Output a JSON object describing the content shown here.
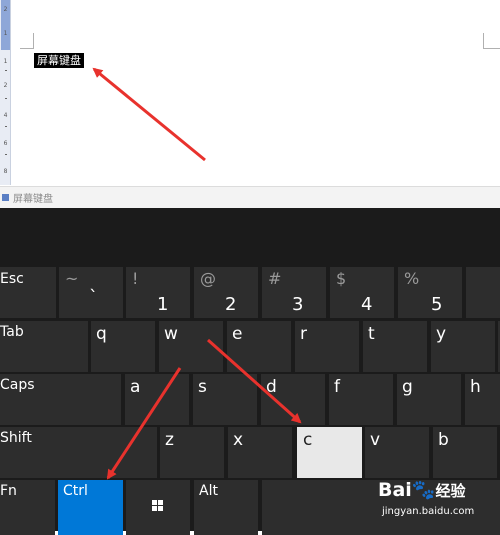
{
  "document": {
    "selected_text": "屏幕键盘",
    "ruler_numbers": [
      "2",
      "1",
      "1",
      "2",
      "4",
      "6",
      "8"
    ]
  },
  "osk_window": {
    "title": "屏幕键盘"
  },
  "keyboard": {
    "row1": [
      {
        "shift": "",
        "main": "Esc"
      },
      {
        "shift": "~",
        "main": "`"
      },
      {
        "shift": "!",
        "main": "1"
      },
      {
        "shift": "@",
        "main": "2"
      },
      {
        "shift": "#",
        "main": "3"
      },
      {
        "shift": "$",
        "main": "4"
      },
      {
        "shift": "%",
        "main": "5"
      }
    ],
    "row2": [
      "Tab",
      "q",
      "w",
      "e",
      "r",
      "t",
      "y"
    ],
    "row3": [
      "Caps",
      "a",
      "s",
      "d",
      "f",
      "g",
      "h"
    ],
    "row4": [
      "Shift",
      "z",
      "x",
      "c",
      "v",
      "b"
    ],
    "row5": [
      "Fn",
      "Ctrl",
      "",
      "Alt"
    ],
    "pressed_key": "c",
    "active_key": "Ctrl",
    "colors": {
      "background": "#1b1b1b",
      "key": "#2d2d2d",
      "active": "#0078d7",
      "pressed": "#e8e8e8",
      "annotation_arrow": "#e8322d"
    }
  },
  "watermark": {
    "brand_prefix": "Bai",
    "brand_suffix": "经验",
    "url": "jingyan.baidu.com"
  }
}
